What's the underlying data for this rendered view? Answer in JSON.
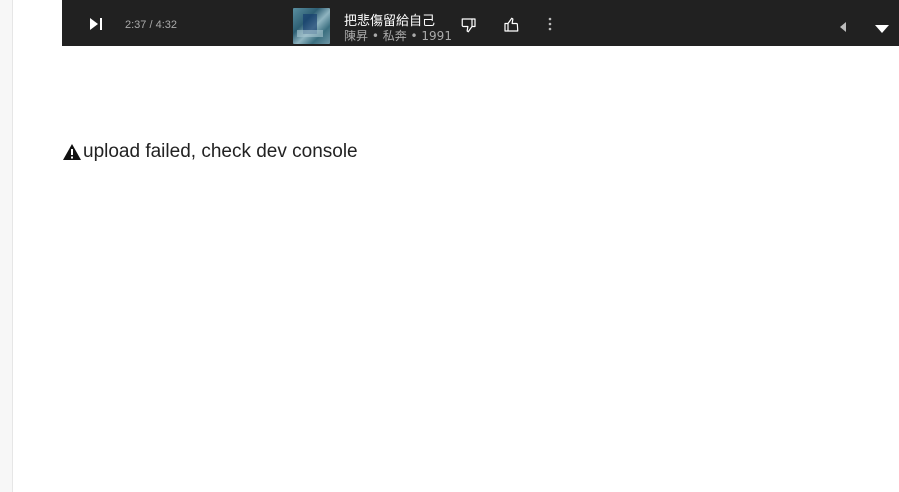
{
  "player": {
    "time": "2:37 / 4:32",
    "track_title": "把悲傷留給自己",
    "track_subtitle": "陳昇 • 私奔 • 1991",
    "icons": [
      "next-icon",
      "album-art",
      "dislike-icon",
      "like-icon",
      "more-vert-icon",
      "previous-arrow-icon",
      "dropdown-arrow-icon"
    ]
  },
  "message": {
    "icon": "warning-icon",
    "text": "upload failed, check dev console"
  },
  "colors": {
    "player_bg": "#212121",
    "player_text": "#ffffff",
    "player_subtext": "#aaaaaa",
    "page_bg": "#ffffff"
  }
}
